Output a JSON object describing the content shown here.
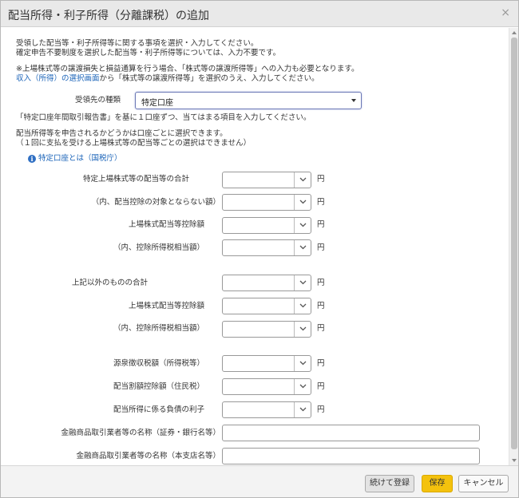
{
  "dialog": {
    "title": "配当所得・利子所得（分離課税）の追加",
    "close_glyph": "×"
  },
  "intro": {
    "line1": "受領した配当等・利子所得等に関する事項を選択・入力してください。",
    "line2": "確定申告不要制度を選択した配当等・利子所得等については、入力不要です。",
    "note1": "※上場株式等の譲渡損失と損益通算を行う場合、「株式等の譲渡所得等」への入力も必要となります。",
    "note2_link": "収入（所得）の選択画面",
    "note2_rest": "から「株式等の譲渡所得等」を選択のうえ、入力してください。"
  },
  "account_type": {
    "label": "受領先の種類",
    "value": "特定口座"
  },
  "account_notes": {
    "line1": "「特定口座年間取引報告書」を基に１口座ずつ、当てはまる項目を入力してください。",
    "line2": "配当所得等を申告されるかどうかは口座ごとに選択できます。",
    "line3": "（１回に支払を受ける上場株式等の配当等ごとの選択はできません）",
    "info_link": "特定口座とは（国税庁）"
  },
  "fields": [
    {
      "label": "特定上場株式等の配当等の合計",
      "unit": "円"
    },
    {
      "label": "（内、配当控除の対象とならない額）",
      "unit": "円"
    },
    {
      "label": "上場株式配当等控除額",
      "unit": "円"
    },
    {
      "label": "（内、控除所得税相当額）",
      "unit": "円"
    },
    {
      "label": "上記以外のものの合計",
      "unit": "円"
    },
    {
      "label": "上場株式配当等控除額",
      "unit": "円"
    },
    {
      "label": "（内、控除所得税相当額）",
      "unit": "円"
    },
    {
      "label": "源泉徴収税額（所得税等）",
      "unit": "円"
    },
    {
      "label": "配当割額控除額（住民税）",
      "unit": "円"
    },
    {
      "label": "配当所得に係る負債の利子",
      "unit": "円"
    }
  ],
  "text_fields": [
    {
      "label": "金融商品取引業者等の名称（証券・銀行名等）",
      "value": ""
    },
    {
      "label": "金融商品取引業者等の名称（本支店名等）",
      "value": ""
    }
  ],
  "footer": {
    "continue_label": "続けて登録",
    "save_label": "保存",
    "cancel_label": "キャンセル"
  },
  "colors": {
    "save_button": "#f4c20d",
    "link": "#1a63b8",
    "info_icon": "#2f6fc3"
  }
}
